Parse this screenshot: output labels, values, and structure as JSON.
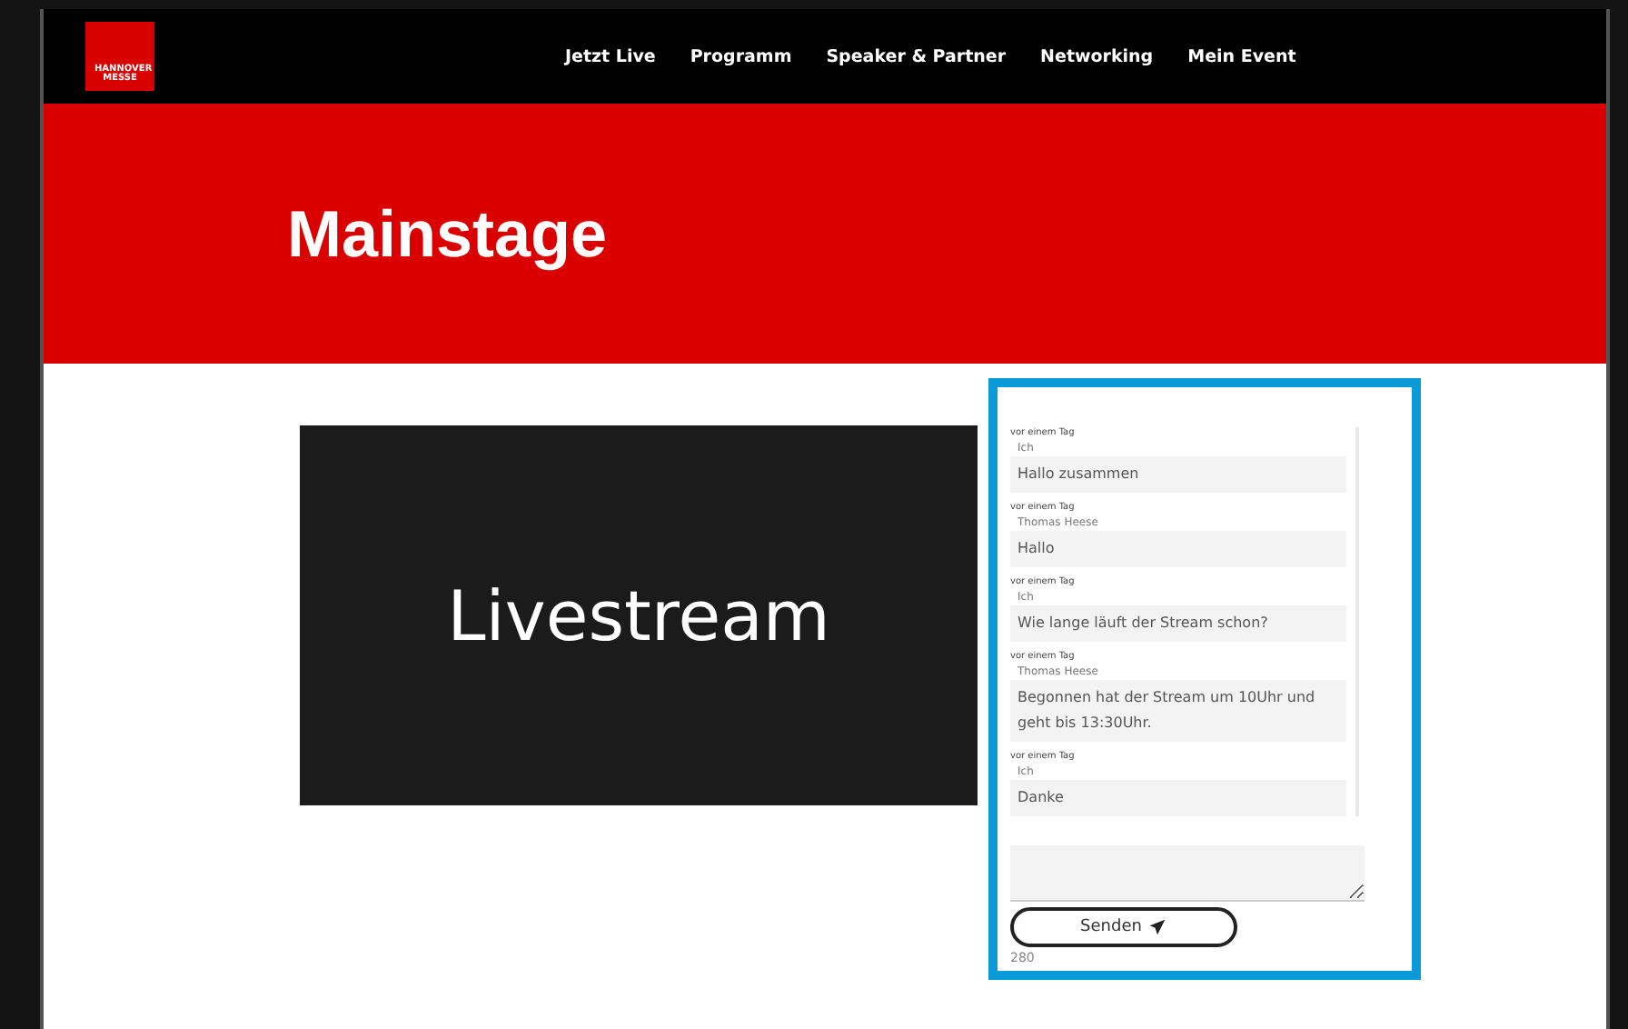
{
  "logo": {
    "text": "HANNOVER MESSE"
  },
  "nav": [
    "Jetzt Live",
    "Programm",
    "Speaker & Partner",
    "Networking",
    "Mein Event"
  ],
  "banner": {
    "title": "Mainstage"
  },
  "video": {
    "label": "Livestream"
  },
  "chat": {
    "messages": [
      {
        "time": "vor einem Tag",
        "author": "Ich",
        "text": "Hallo zusammen"
      },
      {
        "time": "vor einem Tag",
        "author": "Thomas Heese",
        "text": "Hallo"
      },
      {
        "time": "vor einem Tag",
        "author": "Ich",
        "text": "Wie lange läuft der Stream schon?"
      },
      {
        "time": "vor einem Tag",
        "author": "Thomas Heese",
        "text": "Begonnen hat der Stream um 10Uhr und geht bis 13:30Uhr."
      },
      {
        "time": "vor einem Tag",
        "author": "Ich",
        "text": "Danke"
      }
    ],
    "send_label": "Senden",
    "counter": "280"
  }
}
